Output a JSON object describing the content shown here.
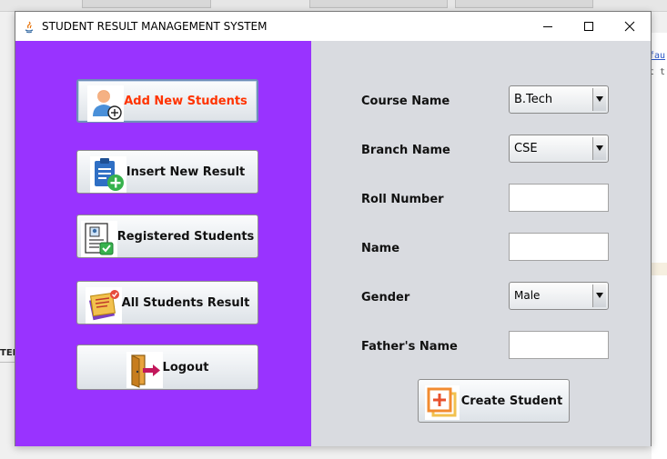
{
  "window": {
    "title": "STUDENT RESULT MANAGEMENT SYSTEM"
  },
  "background": {
    "left_text": "TEM",
    "code_line1": "fau",
    "code_line2": "t t"
  },
  "sidebar": {
    "items": [
      {
        "label": "Add New Students",
        "icon": "add-user-icon",
        "active": true
      },
      {
        "label": "Insert New Result",
        "icon": "clipboard-add-icon"
      },
      {
        "label": "Registered Students",
        "icon": "registered-document-icon"
      },
      {
        "label": "All Students Result",
        "icon": "results-stack-icon"
      },
      {
        "label": "Logout",
        "icon": "logout-door-icon"
      }
    ]
  },
  "form": {
    "course": {
      "label": "Course Name",
      "value": "B.Tech"
    },
    "branch": {
      "label": "Branch Name",
      "value": "CSE"
    },
    "roll": {
      "label": "Roll Number",
      "value": ""
    },
    "name": {
      "label": "Name",
      "value": ""
    },
    "gender": {
      "label": "Gender",
      "value": "Male"
    },
    "father": {
      "label": "Father's Name",
      "value": ""
    },
    "submit_label": "Create Student"
  },
  "colors": {
    "sidebar_bg": "#9933ff",
    "form_bg": "#d9dbe0",
    "active_label": "#ff3300"
  }
}
